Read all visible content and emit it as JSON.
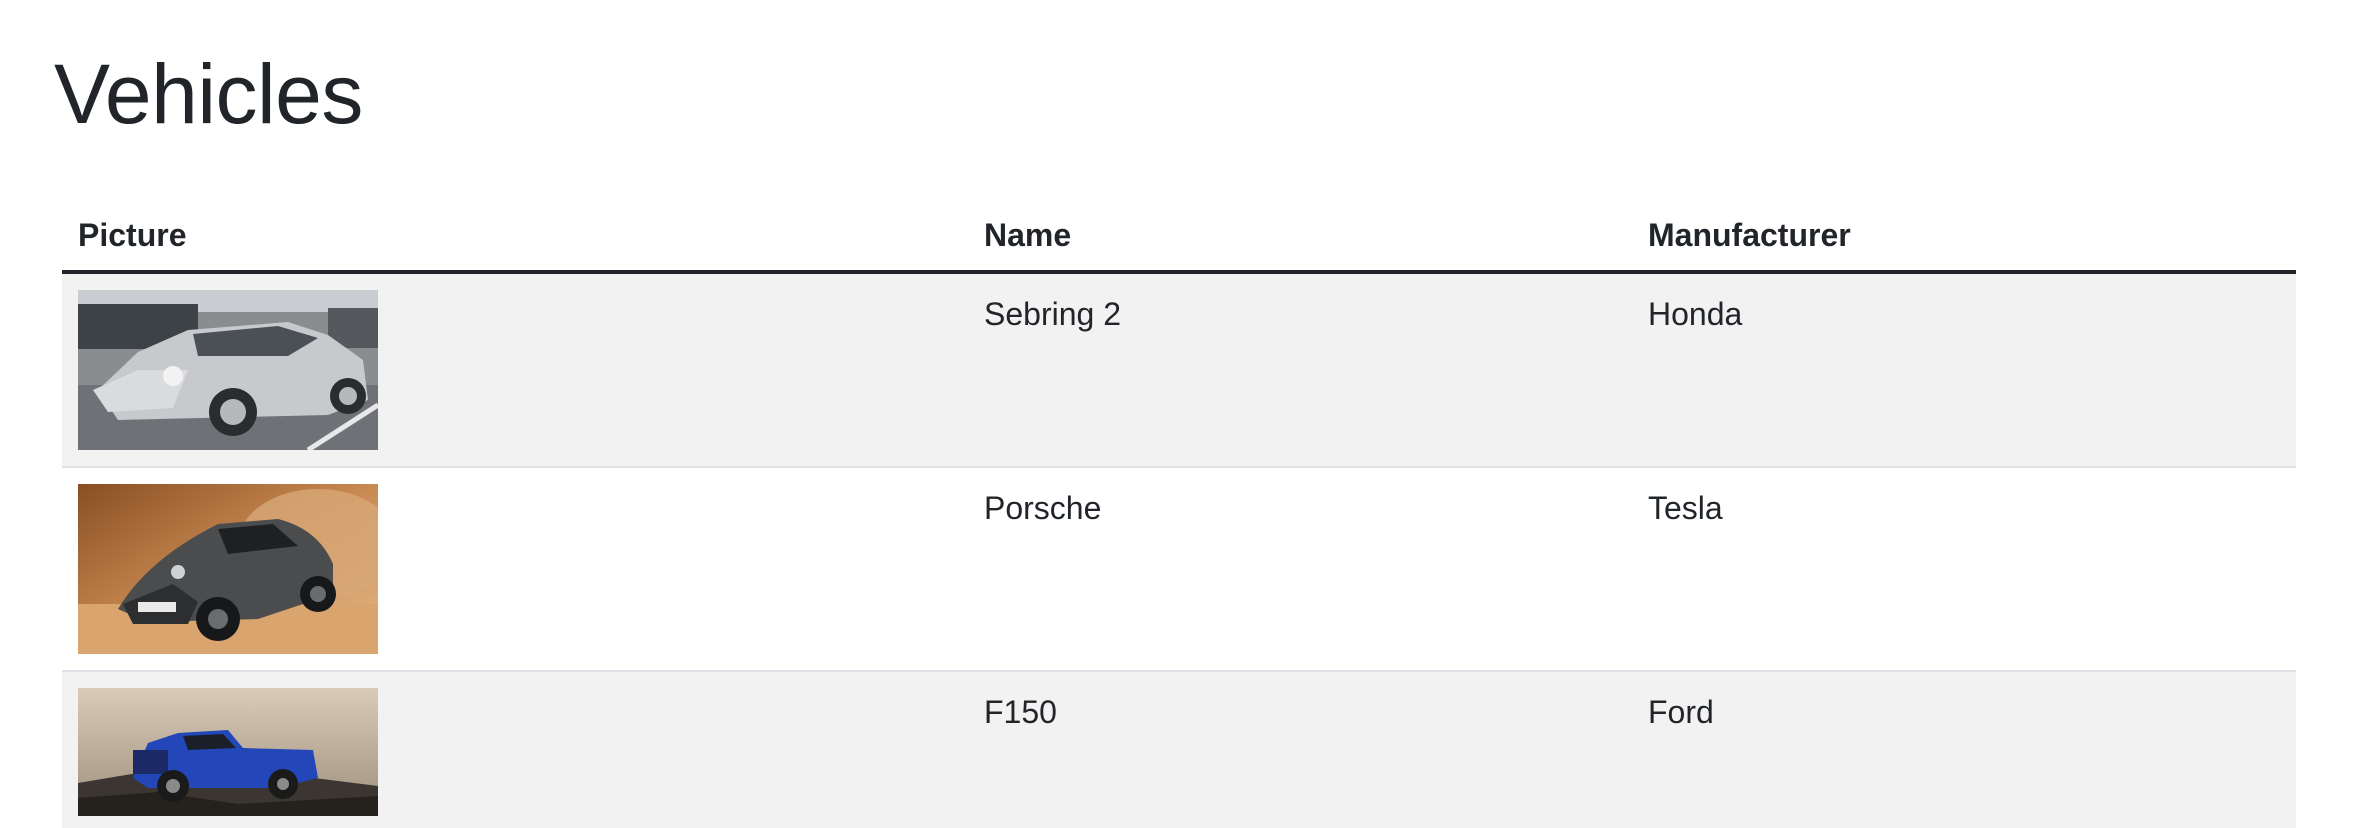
{
  "page": {
    "title": "Vehicles"
  },
  "table": {
    "headers": {
      "picture": "Picture",
      "name": "Name",
      "manufacturer": "Manufacturer"
    },
    "rows": [
      {
        "name": "Sebring 2",
        "manufacturer": "Honda",
        "picture": "silver-sedan-photo"
      },
      {
        "name": "Porsche",
        "manufacturer": "Tesla",
        "picture": "grey-sports-car-in-desert-photo"
      },
      {
        "name": "F150",
        "manufacturer": "Ford",
        "picture": "blue-pickup-truck-offroad-photo"
      }
    ]
  },
  "colors": {
    "text": "#212529",
    "stripe": "#f2f2f2",
    "row_border": "#dee2e6",
    "header_border": "#212529"
  }
}
